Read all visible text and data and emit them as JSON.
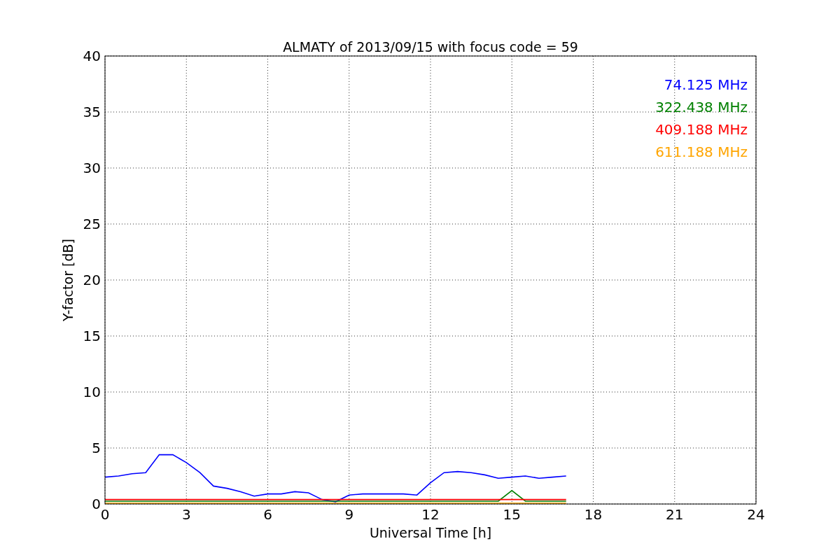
{
  "figure": {
    "chart_data": {
      "type": "line",
      "title": "ALMATY of 2013/09/15 with focus code = 59",
      "xlabel": "Universal Time [h]",
      "ylabel": "Y-factor [dB]",
      "x": [
        0,
        0.5,
        1,
        1.5,
        2,
        2.5,
        3,
        3.5,
        4,
        4.5,
        5,
        5.5,
        6,
        6.5,
        7,
        7.5,
        8,
        8.5,
        9,
        9.5,
        10,
        10.5,
        11,
        11.5,
        12,
        12.5,
        13,
        13.5,
        14,
        14.5,
        15,
        15.5,
        16,
        16.5,
        17
      ],
      "series": [
        {
          "name": "74.125 MHz",
          "color": "#0000ff",
          "values": [
            2.4,
            2.5,
            2.7,
            2.8,
            4.4,
            4.4,
            3.7,
            2.8,
            1.6,
            1.4,
            1.1,
            0.7,
            0.9,
            0.9,
            1.1,
            1.0,
            0.4,
            0.2,
            0.8,
            0.9,
            0.9,
            0.9,
            0.9,
            0.8,
            1.9,
            2.8,
            2.9,
            2.8,
            2.6,
            2.3,
            2.4,
            2.5,
            2.3,
            2.4,
            2.5
          ]
        },
        {
          "name": "322.438 MHz",
          "color": "#008000",
          "values": [
            0.25,
            0.25,
            0.25,
            0.25,
            0.25,
            0.25,
            0.25,
            0.25,
            0.25,
            0.25,
            0.25,
            0.25,
            0.25,
            0.25,
            0.25,
            0.25,
            0.25,
            0.25,
            0.25,
            0.25,
            0.25,
            0.25,
            0.25,
            0.25,
            0.25,
            0.25,
            0.25,
            0.25,
            0.25,
            0.25,
            1.2,
            0.25,
            0.25,
            0.25,
            0.25
          ]
        },
        {
          "name": "409.188 MHz",
          "color": "#ff0000",
          "values": [
            0.4,
            0.4,
            0.4,
            0.4,
            0.4,
            0.4,
            0.4,
            0.4,
            0.4,
            0.4,
            0.4,
            0.4,
            0.4,
            0.4,
            0.4,
            0.4,
            0.4,
            0.4,
            0.4,
            0.4,
            0.4,
            0.4,
            0.4,
            0.4,
            0.4,
            0.4,
            0.4,
            0.4,
            0.4,
            0.4,
            0.4,
            0.4,
            0.4,
            0.4,
            0.4
          ]
        },
        {
          "name": "611.188 MHz",
          "color": "#ffa500",
          "values": [
            0.08,
            0.08,
            0.08,
            0.08,
            0.08,
            0.08,
            0.08,
            0.08,
            0.08,
            0.08,
            0.08,
            0.08,
            0.08,
            0.08,
            0.08,
            0.08,
            0.08,
            0.08,
            0.08,
            0.08,
            0.08,
            0.08,
            0.08,
            0.08,
            0.08,
            0.08,
            0.08,
            0.08,
            0.08,
            0.08,
            0.08,
            0.08,
            0.08,
            0.08,
            0.08
          ]
        }
      ],
      "grid": true,
      "xlim": [
        0,
        24
      ],
      "ylim": [
        0,
        40
      ],
      "xticks": [
        0,
        3,
        6,
        9,
        12,
        15,
        18,
        21,
        24
      ],
      "yticks": [
        0,
        5,
        10,
        15,
        20,
        25,
        30,
        35,
        40
      ]
    }
  }
}
